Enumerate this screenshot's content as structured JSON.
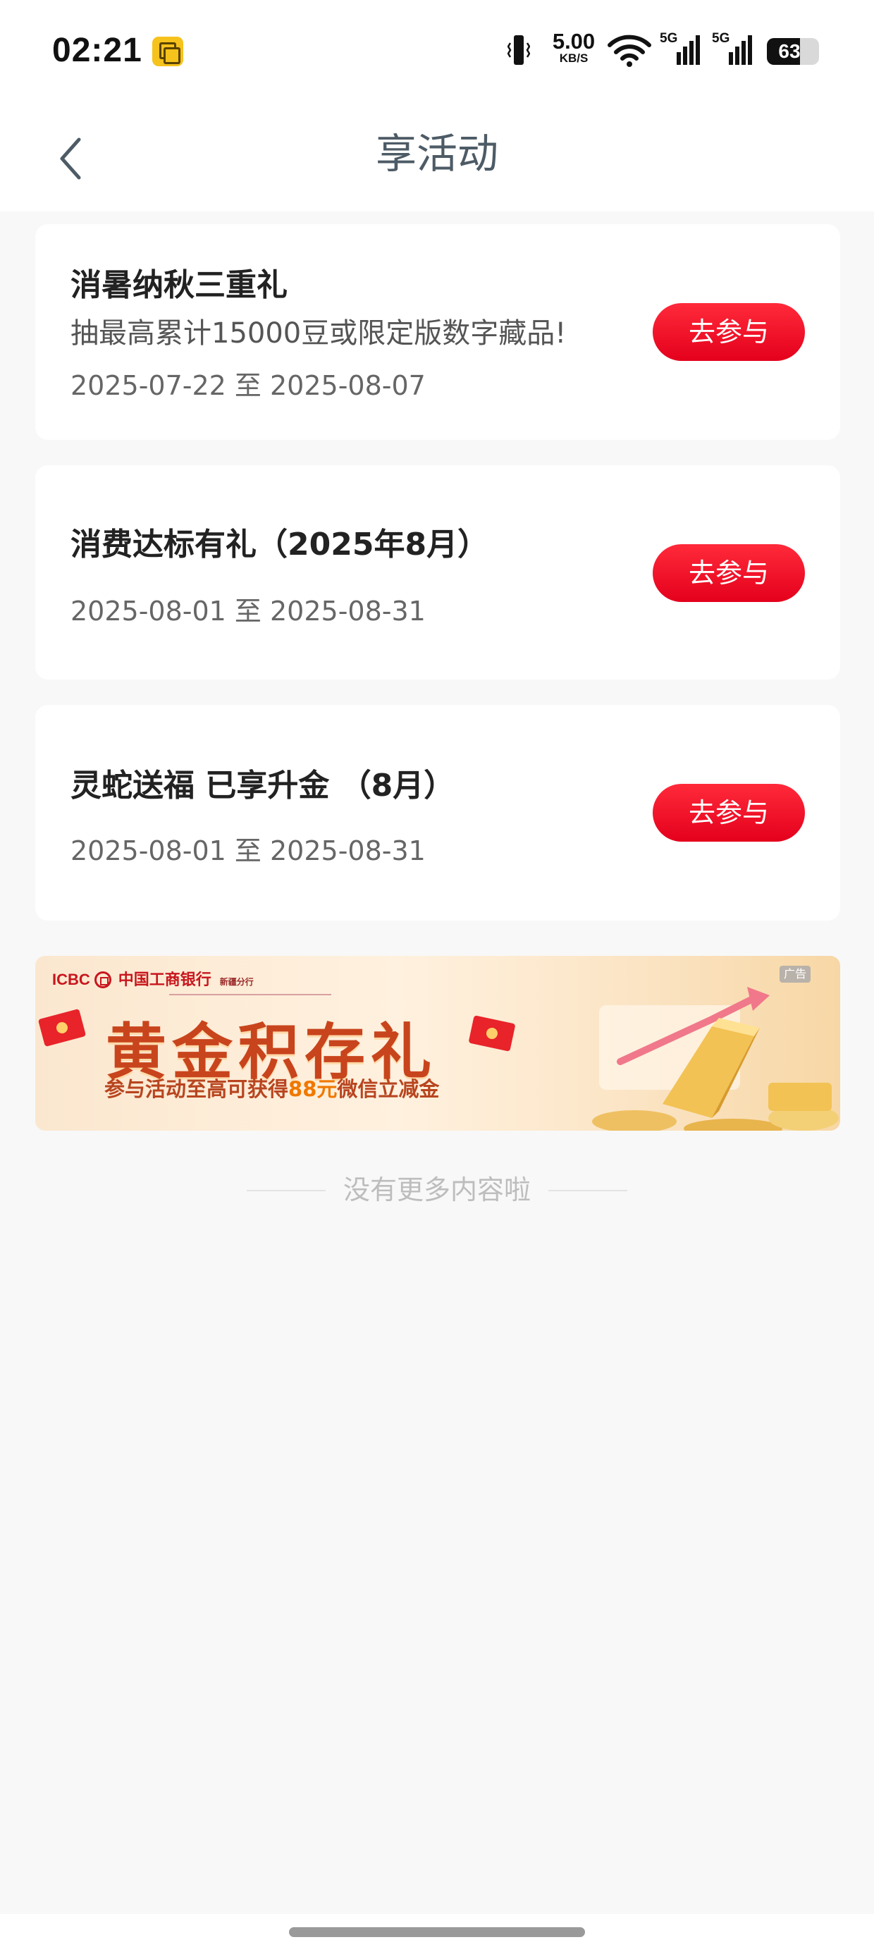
{
  "status_bar": {
    "time": "02:21",
    "net_speed_value": "5.00",
    "net_speed_unit": "KB/S",
    "signal_1_label": "5G",
    "signal_2_label": "5G",
    "battery_level": "63",
    "battery_percent": 63
  },
  "header": {
    "title": "享活动"
  },
  "activities": [
    {
      "title": "消暑纳秋三重礼",
      "description": "抽最高累计15000豆或限定版数字藏品!",
      "date_range": "2025-07-22 至 2025-08-07",
      "button_label": "去参与"
    },
    {
      "title": "消费达标有礼（2025年8月）",
      "date_range": "2025-08-01 至 2025-08-31",
      "button_label": "去参与"
    },
    {
      "title": "灵蛇送福 已享升金 （8月）",
      "date_range": "2025-08-01 至 2025-08-31",
      "button_label": "去参与"
    }
  ],
  "banner": {
    "brand_en": "ICBC",
    "brand_cn": "中国工商银行",
    "branch": "新疆分行",
    "title": "黄金积存礼",
    "subtitle_prefix": "参与活动至高可获得",
    "subtitle_highlight": "88元",
    "subtitle_suffix": "微信立减金",
    "ad_tag": "广告"
  },
  "footer": {
    "no_more_text": "没有更多内容啦"
  },
  "colors": {
    "accent_red": "#e4001c",
    "title_gray": "#4d5b66",
    "banner_gold": "#f7d7a5"
  }
}
